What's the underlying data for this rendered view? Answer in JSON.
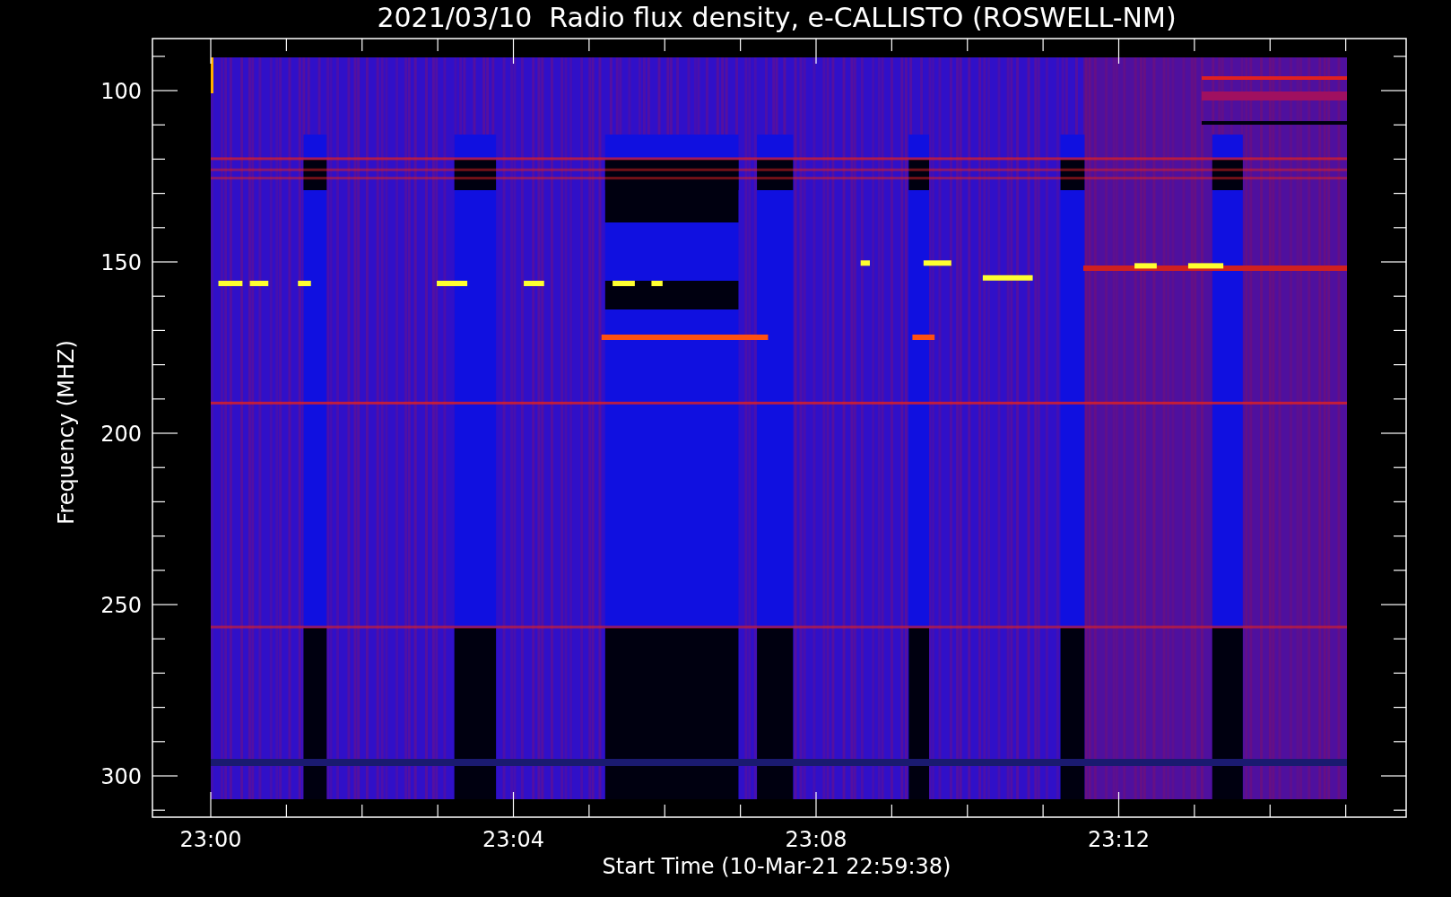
{
  "title": "2021/03/10  Radio flux density, e-CALLISTO (ROSWELL-NM)",
  "y_axis": {
    "label": "Frequency (MHZ)",
    "ticks": [
      "100",
      "150",
      "200",
      "250",
      "300"
    ]
  },
  "x_axis": {
    "label": "Start Time (10-Mar-21 22:59:38)",
    "ticks": [
      "23:00",
      "23:04",
      "23:08",
      "23:12"
    ]
  }
}
